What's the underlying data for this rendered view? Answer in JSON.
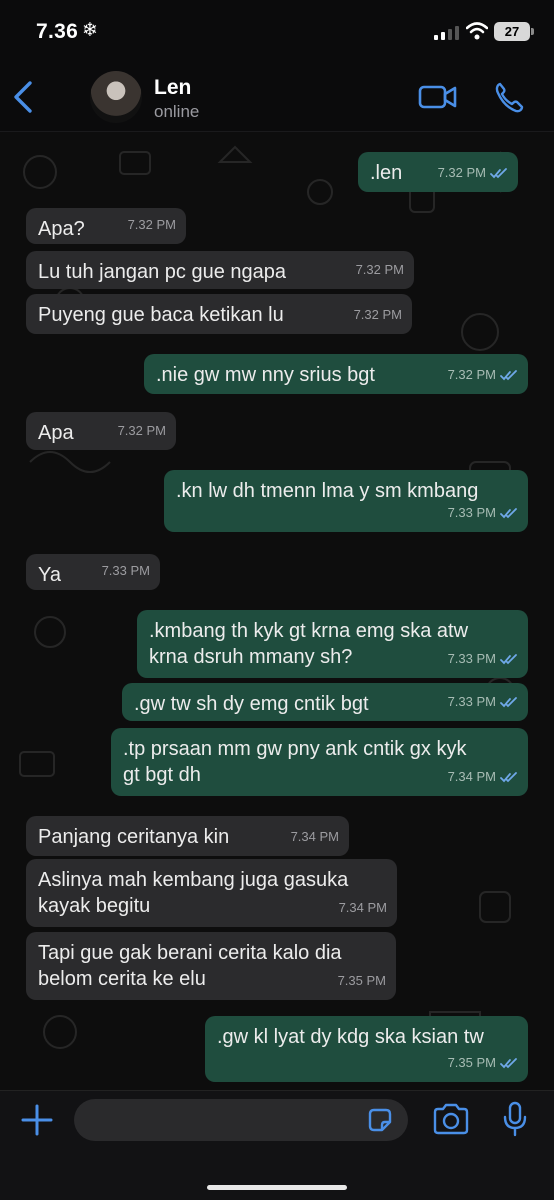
{
  "status_bar": {
    "time": "7.36",
    "weather_glyph": "❄",
    "battery": "27"
  },
  "header": {
    "contact_name": "Len",
    "contact_status": "online"
  },
  "messages": [
    {
      "dir": "out",
      "text": ".len",
      "time": "7.32 PM",
      "read": true
    },
    {
      "dir": "in",
      "text": "Apa?",
      "time": "7.32 PM"
    },
    {
      "dir": "in",
      "text": "Lu tuh jangan pc gue ngapa",
      "time": "7.32 PM"
    },
    {
      "dir": "in",
      "text": "Puyeng gue baca ketikan lu",
      "time": "7.32 PM"
    },
    {
      "dir": "out",
      "text": ".nie gw mw nny srius bgt",
      "time": "7.32 PM",
      "read": true
    },
    {
      "dir": "in",
      "text": "Apa",
      "time": "7.32 PM"
    },
    {
      "dir": "out",
      "text": ".kn lw dh tmenn lma y sm kmbang",
      "time": "7.33 PM",
      "read": true
    },
    {
      "dir": "in",
      "text": "Ya",
      "time": "7.33 PM"
    },
    {
      "dir": "out",
      "text": ".kmbang th kyk gt krna emg ska atw\nkrna dsruh mmany sh?",
      "time": "7.33 PM",
      "read": true
    },
    {
      "dir": "out",
      "text": ".gw tw sh dy emg cntik bgt",
      "time": "7.33 PM",
      "read": true
    },
    {
      "dir": "out",
      "text": ".tp prsaan mm gw pny ank cntik gx kyk\ngt bgt dh",
      "time": "7.34 PM",
      "read": true
    },
    {
      "dir": "in",
      "text": "Panjang ceritanya kin",
      "time": "7.34 PM"
    },
    {
      "dir": "in",
      "text": "Aslinya mah kembang juga gasuka\nkayak begitu",
      "time": "7.34 PM"
    },
    {
      "dir": "in",
      "text": "Tapi gue gak berani cerita kalo dia\nbelom cerita ke elu",
      "time": "7.35 PM"
    },
    {
      "dir": "out",
      "text": ".gw kl lyat dy kdg ska ksian tw",
      "time": "7.35 PM",
      "read": true
    }
  ],
  "icons": {
    "back": "chevron-left-icon",
    "video": "video-camera-icon",
    "call": "phone-icon",
    "plus": "plus-icon",
    "sticker": "sticker-icon",
    "camera": "camera-icon",
    "mic": "microphone-icon"
  },
  "colors": {
    "accent": "#4a8fe7",
    "bubble_in": "#2b2b2d",
    "bubble_out": "#1f4d3e",
    "read_tick": "#6fa8e8"
  }
}
